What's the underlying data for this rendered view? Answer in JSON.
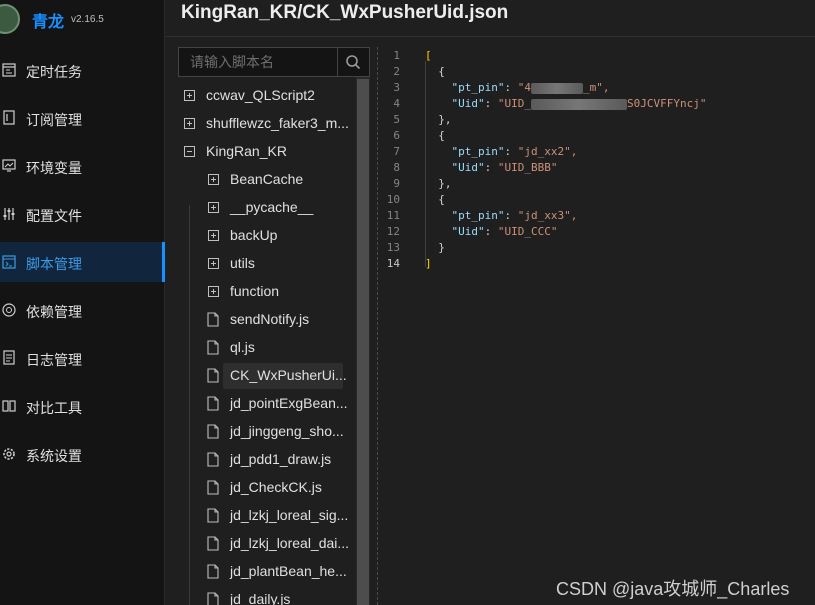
{
  "app": {
    "name": "青龙",
    "version": "v2.16.5"
  },
  "menu": [
    {
      "label": "定时任务",
      "icon": "calendar-icon",
      "active": false
    },
    {
      "label": "订阅管理",
      "icon": "subscribe-icon",
      "active": false
    },
    {
      "label": "环境变量",
      "icon": "monitor-icon",
      "active": false
    },
    {
      "label": "配置文件",
      "icon": "sliders-icon",
      "active": false
    },
    {
      "label": "脚本管理",
      "icon": "script-icon",
      "active": true
    },
    {
      "label": "依赖管理",
      "icon": "dependency-icon",
      "active": false
    },
    {
      "label": "日志管理",
      "icon": "log-icon",
      "active": false
    },
    {
      "label": "对比工具",
      "icon": "diff-icon",
      "active": false
    },
    {
      "label": "系统设置",
      "icon": "gear-icon",
      "active": false
    }
  ],
  "page_title": "KingRan_KR/CK_WxPusherUid.json",
  "search": {
    "placeholder": "请输入脚本名"
  },
  "tree": [
    {
      "label": "ccwav_QLScript2",
      "type": "folder",
      "expanded": false,
      "depth": 0
    },
    {
      "label": "shufflewzc_faker3_m...",
      "type": "folder",
      "expanded": false,
      "depth": 0
    },
    {
      "label": "KingRan_KR",
      "type": "folder",
      "expanded": true,
      "depth": 0
    },
    {
      "label": "BeanCache",
      "type": "folder",
      "expanded": false,
      "depth": 1
    },
    {
      "label": "__pycache__",
      "type": "folder",
      "expanded": false,
      "depth": 1
    },
    {
      "label": "backUp",
      "type": "folder",
      "expanded": false,
      "depth": 1
    },
    {
      "label": "utils",
      "type": "folder",
      "expanded": false,
      "depth": 1
    },
    {
      "label": "function",
      "type": "folder",
      "expanded": false,
      "depth": 1
    },
    {
      "label": "sendNotify.js",
      "type": "file",
      "depth": 1
    },
    {
      "label": "ql.js",
      "type": "file",
      "depth": 1
    },
    {
      "label": "CK_WxPusherUi...",
      "type": "file",
      "depth": 1,
      "selected": true
    },
    {
      "label": "jd_pointExgBean...",
      "type": "file",
      "depth": 1
    },
    {
      "label": "jd_jinggeng_sho...",
      "type": "file",
      "depth": 1
    },
    {
      "label": "jd_pdd1_draw.js",
      "type": "file",
      "depth": 1
    },
    {
      "label": "jd_CheckCK.js",
      "type": "file",
      "depth": 1
    },
    {
      "label": "jd_lzkj_loreal_sig...",
      "type": "file",
      "depth": 1
    },
    {
      "label": "jd_lzkj_loreal_dai...",
      "type": "file",
      "depth": 1
    },
    {
      "label": "jd_plantBean_he...",
      "type": "file",
      "depth": 1
    },
    {
      "label": "jd_daily.js",
      "type": "file",
      "depth": 1
    }
  ],
  "code": {
    "lines": [
      {
        "no": "1"
      },
      {
        "no": "2"
      },
      {
        "no": "3"
      },
      {
        "no": "4"
      },
      {
        "no": "5"
      },
      {
        "no": "6"
      },
      {
        "no": "7"
      },
      {
        "no": "8"
      },
      {
        "no": "9"
      },
      {
        "no": "10"
      },
      {
        "no": "11"
      },
      {
        "no": "12"
      },
      {
        "no": "13"
      },
      {
        "no": "14"
      }
    ],
    "keys": {
      "pin": "\"pt_pin\"",
      "uid": "\"Uid\""
    },
    "values": {
      "pin1_start": "\"4",
      "pin1_end": "_m\",",
      "uid1_start": "\"UID_",
      "uid1_end": "S0JCVFFYncj\"",
      "pin2": "\"jd_xx2\",",
      "uid2": "\"UID_BBB\"",
      "pin3": "\"jd_xx3\",",
      "uid3": "\"UID_CCC\""
    },
    "punct": {
      "open_array": "[",
      "close_array": "]",
      "open_obj": "{",
      "close_obj": "}",
      "close_obj_comma": "},",
      "colon": ": "
    }
  },
  "watermark": "CSDN @java攻城师_Charles",
  "colors": {
    "accent": "#1890ff",
    "background": "#1f1f1f",
    "sidebar": "#141414"
  }
}
